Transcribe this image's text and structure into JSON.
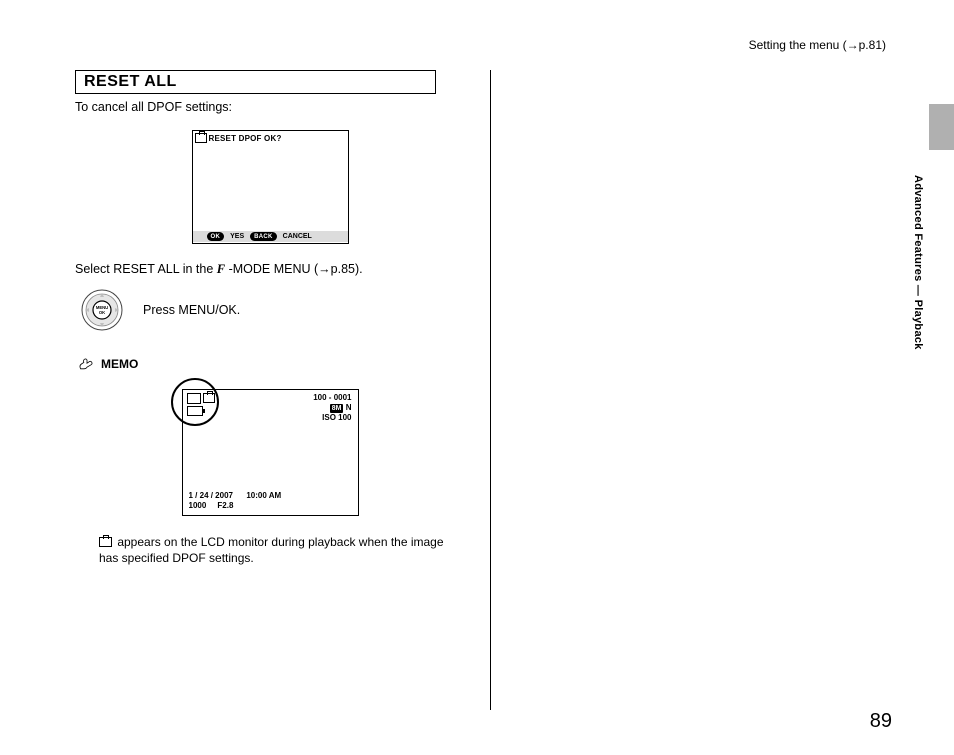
{
  "header": {
    "line": "Setting the menu (→p.81)"
  },
  "section": {
    "title": "RESET ALL",
    "intro": "To cancel all DPOF settings:"
  },
  "lcd1": {
    "prompt": "RESET DPOF OK?",
    "ok_pill": "OK",
    "ok_label": "YES",
    "back_pill": "BACK",
    "back_label": "CANCEL"
  },
  "instr": {
    "prefix": "Select RESET ALL in the ",
    "mode": "F",
    "suffix": " -MODE MENU (→p.85)."
  },
  "press": {
    "text": "Press MENU/OK.",
    "btn": "MENU\nOK"
  },
  "memo": {
    "heading": "MEMO"
  },
  "lcd2": {
    "frame_no": "100 - 0001",
    "size_badge": "8M",
    "size_n": "N",
    "iso": "ISO  100",
    "date": "1 / 24 / 2007",
    "time": "10:00 AM",
    "shutter": "1000",
    "aperture": "F2.8"
  },
  "memo_body": " appears on the LCD monitor during playback when the image has specified DPOF settings.",
  "sidebar": {
    "label": "Advanced Features — Playback"
  },
  "page_number": "89"
}
